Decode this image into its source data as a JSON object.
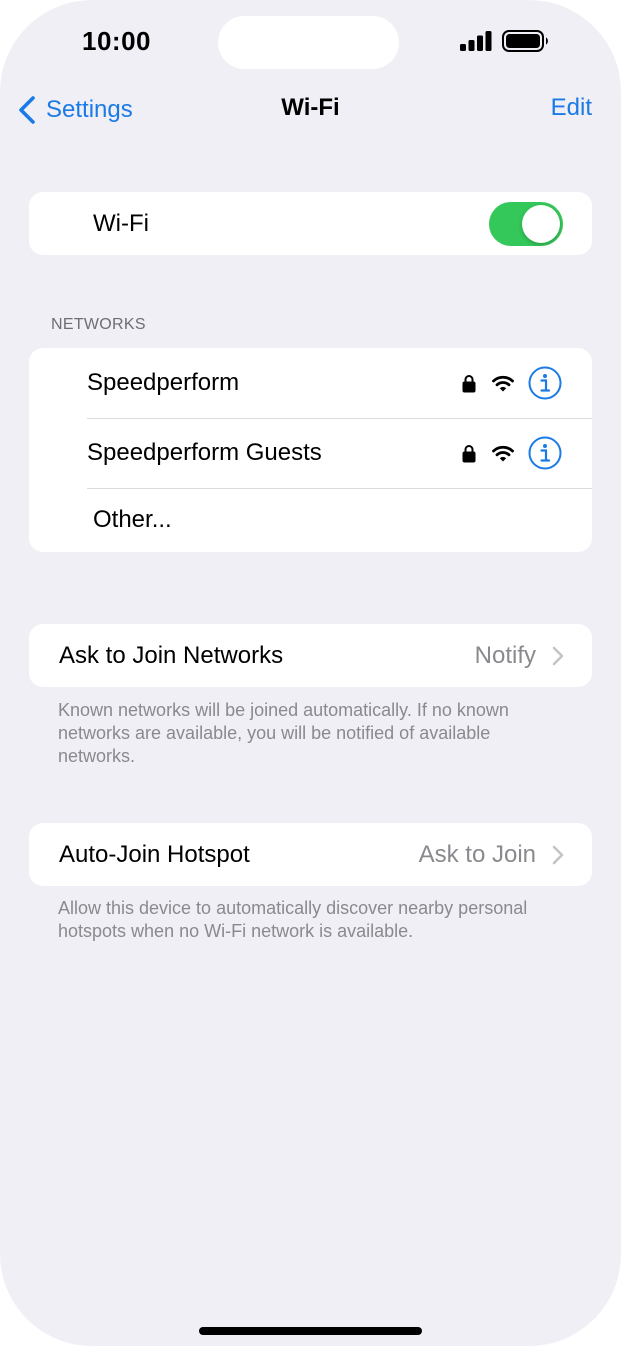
{
  "status_bar": {
    "time": "10:00",
    "signal_icon": "cellular-signal-icon",
    "battery_icon": "battery-icon"
  },
  "nav": {
    "back_label": "Settings",
    "title": "Wi-Fi",
    "edit_label": "Edit"
  },
  "wifi_toggle": {
    "label": "Wi-Fi",
    "on": true,
    "color": "#34c759"
  },
  "networks": {
    "header": "NETWORKS",
    "items": [
      {
        "name": "Speedperform",
        "secured": true
      },
      {
        "name": "Speedperform Guests",
        "secured": true
      }
    ],
    "other_label": "Other..."
  },
  "ask_to_join": {
    "label": "Ask to Join Networks",
    "value": "Notify",
    "footnote": "Known networks will be joined automatically. If no known networks are available, you will be notified of available networks."
  },
  "auto_join_hotspot": {
    "label": "Auto-Join Hotspot",
    "value": "Ask to Join",
    "footnote": "Allow this device to automatically discover nearby personal hotspots when no Wi-Fi network is available."
  },
  "colors": {
    "accent": "#1a7ae6",
    "background": "#f0eff5",
    "secondary_text": "#8a8a8e"
  }
}
